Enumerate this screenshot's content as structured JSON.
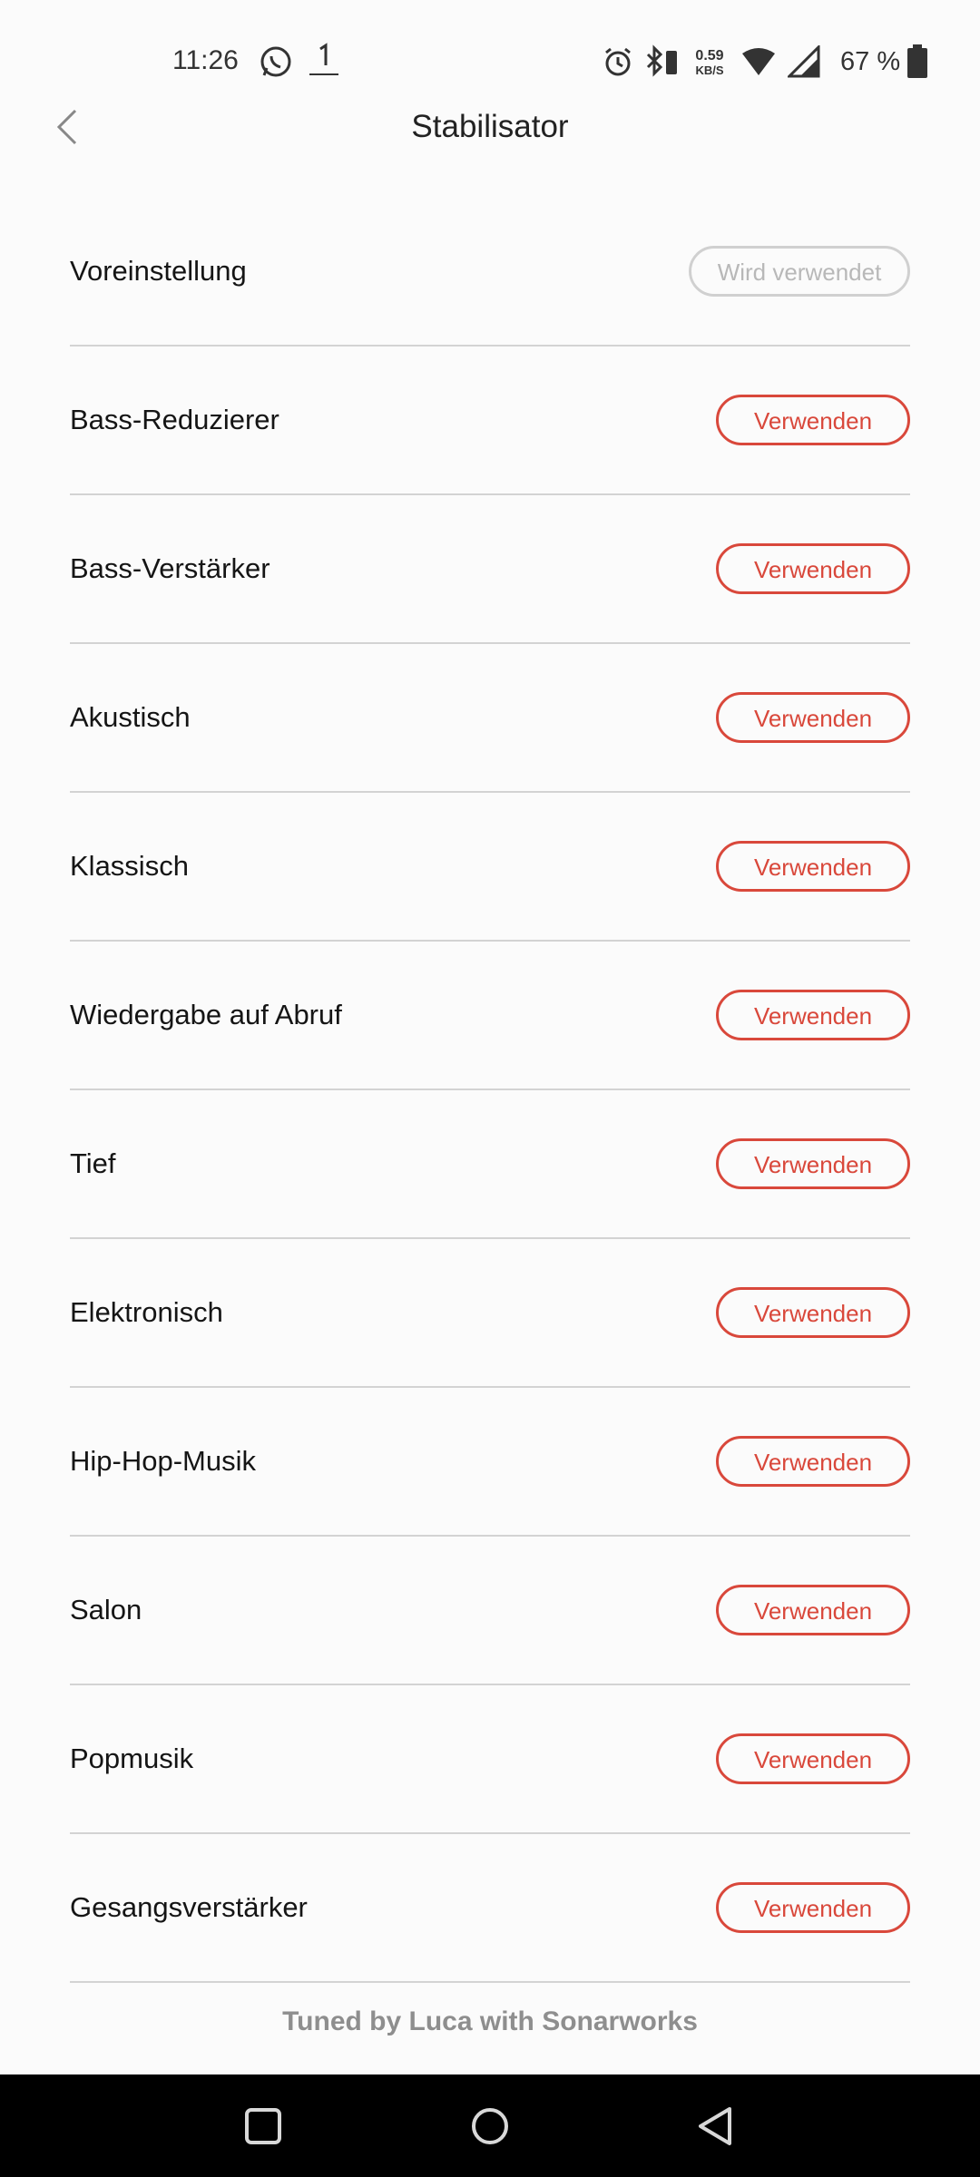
{
  "status_bar": {
    "time": "11:26",
    "net_speed_value": "0.59",
    "net_speed_unit": "KB/S",
    "battery_percent": "67 %",
    "icons": [
      "whatsapp-icon",
      "app-notification-icon",
      "alarm-icon",
      "bluetooth-icon",
      "wifi-icon",
      "cellular-signal-icon",
      "battery-icon"
    ]
  },
  "header": {
    "title": "Stabilisator",
    "back_icon": "chevron-left-icon"
  },
  "presets": [
    {
      "label": "Voreinstellung",
      "button": "Wird verwendet",
      "state": "in-use"
    },
    {
      "label": "Bass-Reduzierer",
      "button": "Verwenden",
      "state": "available"
    },
    {
      "label": "Bass-Verstärker",
      "button": "Verwenden",
      "state": "available"
    },
    {
      "label": "Akustisch",
      "button": "Verwenden",
      "state": "available"
    },
    {
      "label": "Klassisch",
      "button": "Verwenden",
      "state": "available"
    },
    {
      "label": "Wiedergabe auf Abruf",
      "button": "Verwenden",
      "state": "available"
    },
    {
      "label": "Tief",
      "button": "Verwenden",
      "state": "available"
    },
    {
      "label": "Elektronisch",
      "button": "Verwenden",
      "state": "available"
    },
    {
      "label": "Hip-Hop-Musik",
      "button": "Verwenden",
      "state": "available"
    },
    {
      "label": "Salon",
      "button": "Verwenden",
      "state": "available"
    },
    {
      "label": "Popmusik",
      "button": "Verwenden",
      "state": "available"
    },
    {
      "label": "Gesangsverstärker",
      "button": "Verwenden",
      "state": "available"
    }
  ],
  "footer": {
    "credit": "Tuned by Luca with Sonarworks"
  },
  "nav_bar": {
    "icons": [
      "recent-apps-icon",
      "home-icon",
      "back-icon"
    ]
  },
  "colors": {
    "accent": "#d9483b",
    "in_use_border": "#d0d0d0",
    "in_use_text": "#b8b8b8",
    "divider": "#d3d3d3",
    "background": "#fbfbfb"
  }
}
